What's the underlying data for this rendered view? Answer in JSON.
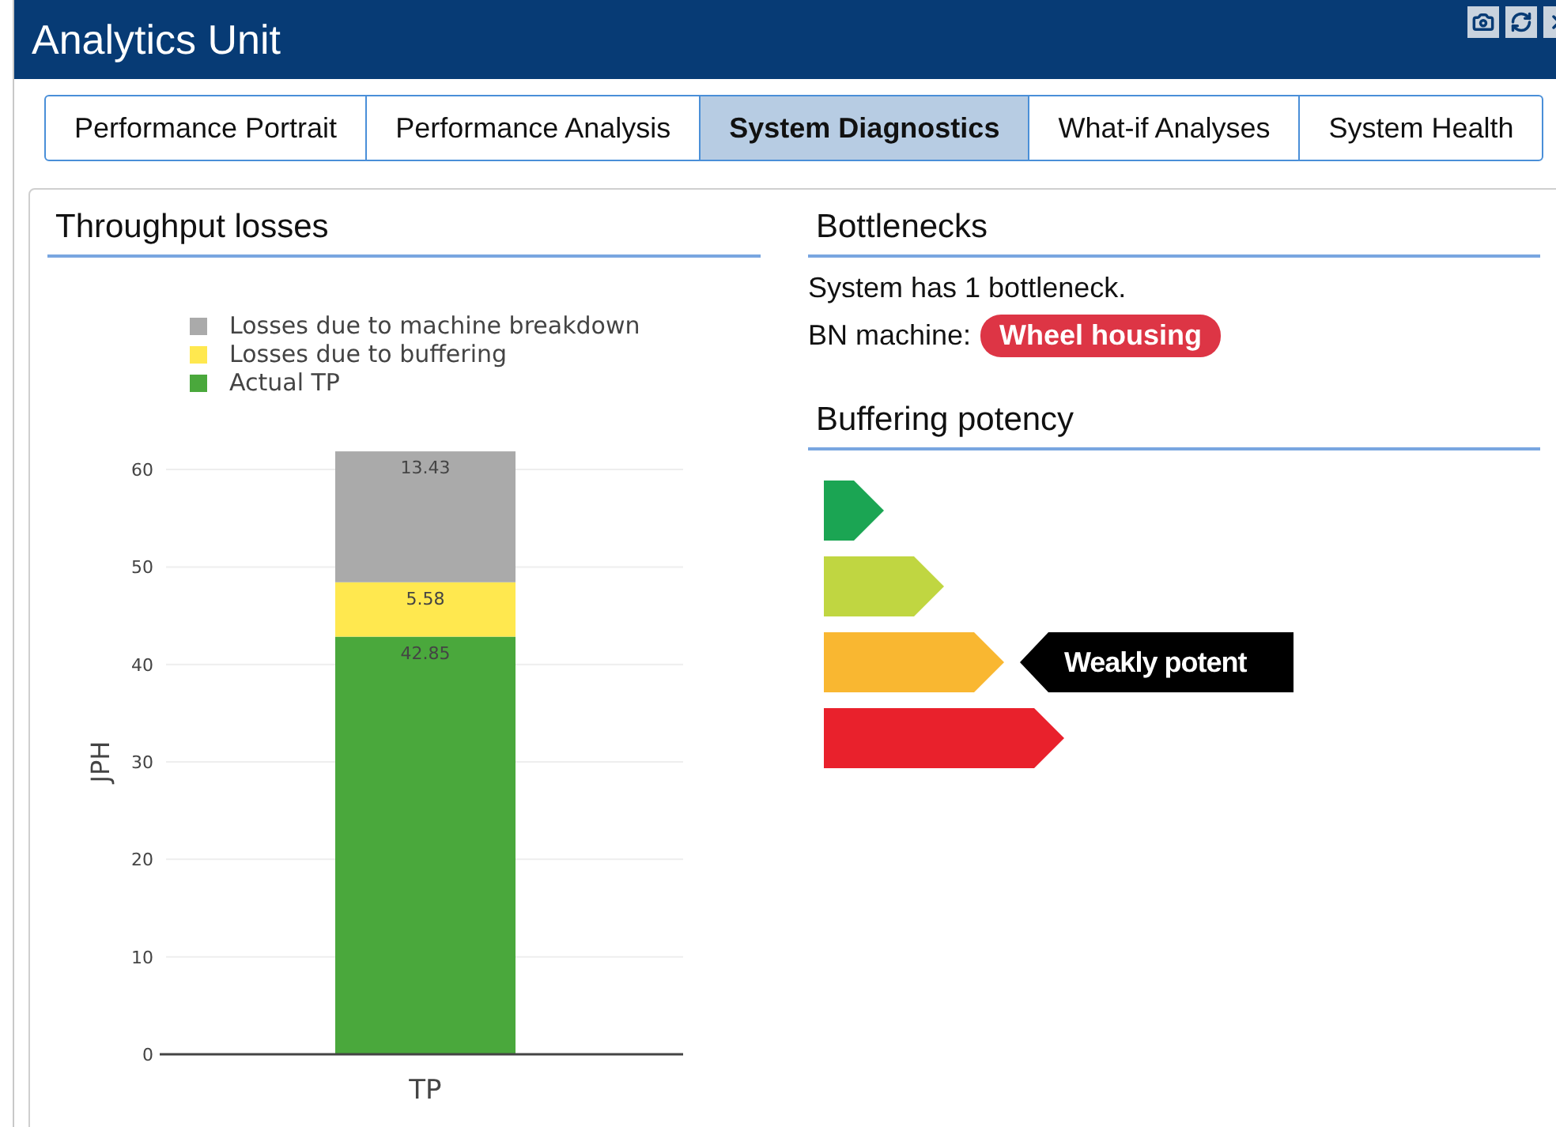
{
  "window": {
    "title": "Analytics Unit"
  },
  "tabs": [
    {
      "label": "Performance Portrait",
      "selected": false
    },
    {
      "label": "Performance Analysis",
      "selected": false
    },
    {
      "label": "System Diagnostics",
      "selected": true
    },
    {
      "label": "What-if Analyses",
      "selected": false
    },
    {
      "label": "System Health",
      "selected": false
    }
  ],
  "throughput": {
    "title": "Throughput losses",
    "chart_data": {
      "type": "bar",
      "stacked": true,
      "categories": [
        "TP"
      ],
      "ylabel": "JPH",
      "yticks": [
        0,
        10,
        20,
        30,
        40,
        50,
        60
      ],
      "ylim": [
        0,
        62
      ],
      "grid": true,
      "legend": true,
      "data_labels": true,
      "series": [
        {
          "name": "Losses due to machine breakdown",
          "color": "#aaaaaa",
          "values": [
            13.43
          ]
        },
        {
          "name": "Losses due to buffering",
          "color": "#ffe84f",
          "values": [
            5.58
          ]
        },
        {
          "name": "Actual TP",
          "color": "#4aa83c",
          "values": [
            42.85
          ]
        }
      ]
    }
  },
  "bottlenecks": {
    "title": "Bottlenecks",
    "summary": "System has 1 bottleneck.",
    "machine_label": "BN machine:",
    "machine": "Wheel housing"
  },
  "buffering": {
    "title": "Buffering potency",
    "indicator": "Weakly potent",
    "levels": [
      {
        "color": "#1ba553",
        "selected": false
      },
      {
        "color": "#c0d641",
        "selected": false
      },
      {
        "color": "#f9b731",
        "selected": true
      },
      {
        "color": "#e9212c",
        "selected": false
      }
    ]
  }
}
